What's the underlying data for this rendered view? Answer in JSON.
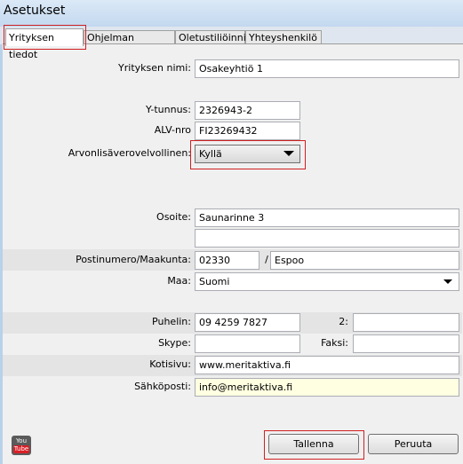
{
  "window": {
    "title": "Asetukset"
  },
  "tabs": [
    {
      "label": "Yrityksen tiedot"
    },
    {
      "label": "Ohjelman asetukset"
    },
    {
      "label": "Oletustiliöinnit"
    },
    {
      "label": "Yhteyshenkilö"
    }
  ],
  "form": {
    "company_name": {
      "label": "Yrityksen nimi:",
      "value": "Osakeyhtiö 1"
    },
    "business_id": {
      "label": "Y-tunnus:",
      "value": "2326943-2"
    },
    "vat_number": {
      "label": "ALV-nro",
      "value": "FI23269432"
    },
    "vat_liable": {
      "label": "Arvonlisäverovelvollinen:",
      "value": "Kyllä"
    },
    "address": {
      "label": "Osoite:",
      "value": "Saunarinne 3",
      "value2": ""
    },
    "postal": {
      "label": "Postinumero/Maakunta:",
      "code": "02330",
      "separator": "/",
      "city": "Espoo"
    },
    "country": {
      "label": "Maa:",
      "value": "Suomi"
    },
    "phone": {
      "label": "Puhelin:",
      "value": "09 4259 7827",
      "label2": "2:",
      "value2": ""
    },
    "skype": {
      "label": "Skype:",
      "value": ""
    },
    "fax": {
      "label": "Faksi:",
      "value": ""
    },
    "website": {
      "label": "Kotisivu:",
      "value": "www.meritaktiva.fi"
    },
    "email": {
      "label": "Sähköposti:",
      "value": "info@meritaktiva.fi"
    }
  },
  "buttons": {
    "save": "Tallenna",
    "cancel": "Peruuta"
  },
  "youtube": {
    "top": "You",
    "bottom": "Tube"
  },
  "colors": {
    "highlight": "#d02020",
    "email_bg": "#ffffe1"
  }
}
